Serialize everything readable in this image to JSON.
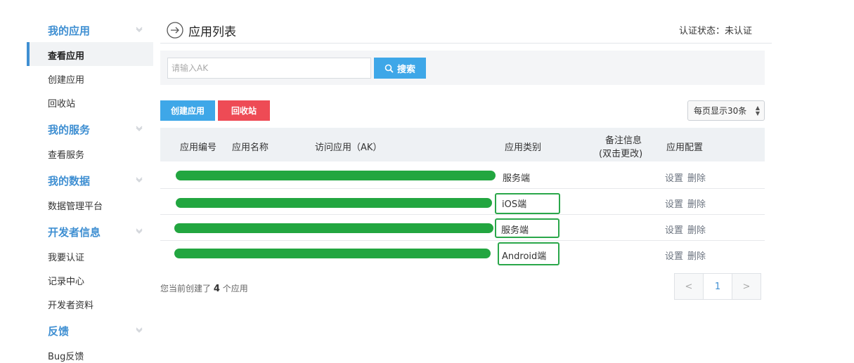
{
  "sidebar": {
    "sections": [
      {
        "label": "我的应用",
        "items": [
          "查看应用",
          "创建应用",
          "回收站"
        ]
      },
      {
        "label": "我的服务",
        "items": [
          "查看服务"
        ]
      },
      {
        "label": "我的数据",
        "items": [
          "数据管理平台"
        ]
      },
      {
        "label": "开发者信息",
        "items": [
          "我要认证",
          "记录中心",
          "开发者资料"
        ]
      },
      {
        "label": "反馈",
        "items": [
          "Bug反馈"
        ]
      }
    ],
    "active_item": "查看应用"
  },
  "header": {
    "title": "应用列表",
    "auth_label": "认证状态：",
    "auth_value": "未认证",
    "arrow_icon": "arrow-right-circle-icon"
  },
  "search": {
    "placeholder": "请输入AK",
    "value": "",
    "button_label": "搜索",
    "button_icon": "search-icon"
  },
  "actions": {
    "create_label": "创建应用",
    "recycle_label": "回收站",
    "per_page_label": "每页显示30条"
  },
  "table": {
    "columns": [
      "应用编号",
      "应用名称",
      "访问应用（AK）",
      "应用类别",
      "备注信息",
      "(双击更改)",
      "应用配置"
    ],
    "rows": [
      {
        "type": "服务端",
        "config": [
          "设置",
          "删除"
        ],
        "highlighted": false
      },
      {
        "type": "iOS端",
        "config": [
          "设置",
          "删除"
        ],
        "highlighted": true
      },
      {
        "type": "服务端",
        "config": [
          "设置",
          "删除"
        ],
        "highlighted": true
      },
      {
        "type": "Android端",
        "config": [
          "设置",
          "删除"
        ],
        "highlighted": true
      }
    ]
  },
  "summary": {
    "prefix": "您当前创建了",
    "count": "4",
    "suffix": "个应用"
  },
  "pagination": {
    "prev": "<",
    "current": "1",
    "next": ">"
  },
  "colors": {
    "accent": "#3f8fd2",
    "primary_button": "#3ea7e8",
    "danger_button": "#ee4b55",
    "redaction": "#22a640",
    "highlight_box": "#2aa74a"
  }
}
